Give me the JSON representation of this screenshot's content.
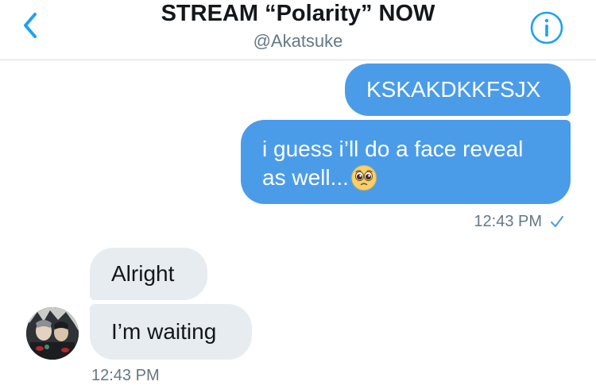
{
  "header": {
    "title": "STREAM “Polarity” NOW",
    "handle": "@Akatsuke",
    "back_icon": "chevron-left-icon",
    "info_icon": "info-icon",
    "accent_color": "#1da1f2"
  },
  "messages": {
    "outgoing": [
      {
        "text": "KSKAKDKKFSJX"
      },
      {
        "line1": "i guess i’ll do a face reveal",
        "line2": "as well...",
        "emoji": "pleading-face-emoji"
      }
    ],
    "outgoing_time": "12:43 PM",
    "outgoing_status_icon": "check-icon",
    "incoming": [
      {
        "text": "Alright"
      },
      {
        "text": "I’m waiting"
      }
    ],
    "incoming_time": "12:43 PM"
  },
  "colors": {
    "outgoing_bubble": "#4a9ce9",
    "incoming_bubble": "#e6ecf0",
    "timestamp": "#657786"
  }
}
